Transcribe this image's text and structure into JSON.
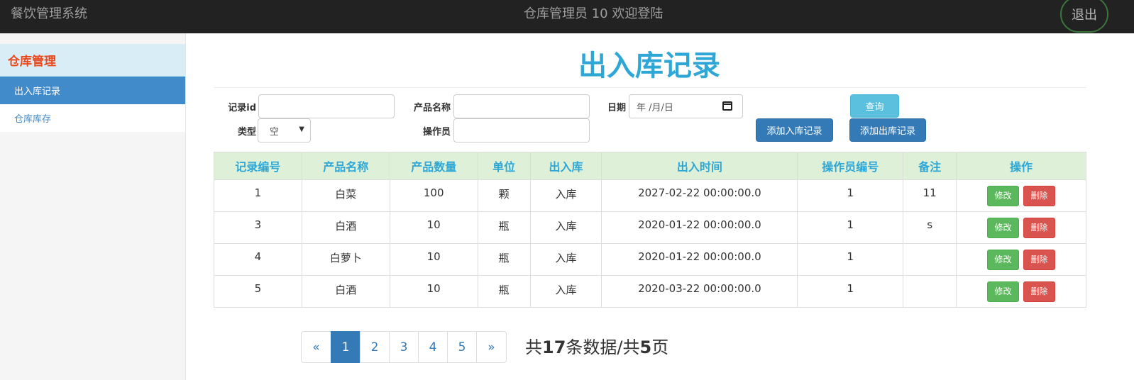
{
  "header": {
    "brand": "餐饮管理系统",
    "welcome": "仓库管理员  10  欢迎登陆",
    "logout": "退出"
  },
  "sidebar": {
    "title": "仓库管理",
    "items": [
      {
        "label": "出入库记录",
        "active": true
      },
      {
        "label": "仓库库存",
        "active": false
      }
    ]
  },
  "page": {
    "title": "出入库记录"
  },
  "form": {
    "record_id_label": "记录id",
    "record_id_value": "",
    "product_label": "产品名称",
    "product_value": "",
    "date_label": "日期",
    "date_placeholder": "年 /月/日",
    "type_label": "类型",
    "type_selected": "空",
    "operator_label": "操作员",
    "operator_value": "",
    "query_button": "查询",
    "add_in_button": "添加入库记录",
    "add_out_button": "添加出库记录"
  },
  "table": {
    "headers": [
      "记录编号",
      "产品名称",
      "产品数量",
      "单位",
      "出入库",
      "出入时间",
      "操作员编号",
      "备注",
      "操作"
    ],
    "rows": [
      [
        "1",
        "白菜",
        "100",
        "颗",
        "入库",
        "2027-02-22 00:00:00.0",
        "1",
        "11"
      ],
      [
        "3",
        "白酒",
        "10",
        "瓶",
        "入库",
        "2020-01-22 00:00:00.0",
        "1",
        "s"
      ],
      [
        "4",
        "白萝卜",
        "10",
        "瓶",
        "入库",
        "2020-01-22 00:00:00.0",
        "1",
        ""
      ],
      [
        "5",
        "白酒",
        "10",
        "瓶",
        "入库",
        "2020-03-22 00:00:00.0",
        "1",
        ""
      ]
    ],
    "edit_label": "修改",
    "delete_label": "删除"
  },
  "pagination": {
    "prev": "«",
    "pages": [
      "1",
      "2",
      "3",
      "4",
      "5"
    ],
    "next": "»",
    "current": "1",
    "summary_prefix": "共",
    "total_records": "17",
    "summary_mid": "条数据/共",
    "total_pages": "5",
    "summary_suffix": "页"
  }
}
